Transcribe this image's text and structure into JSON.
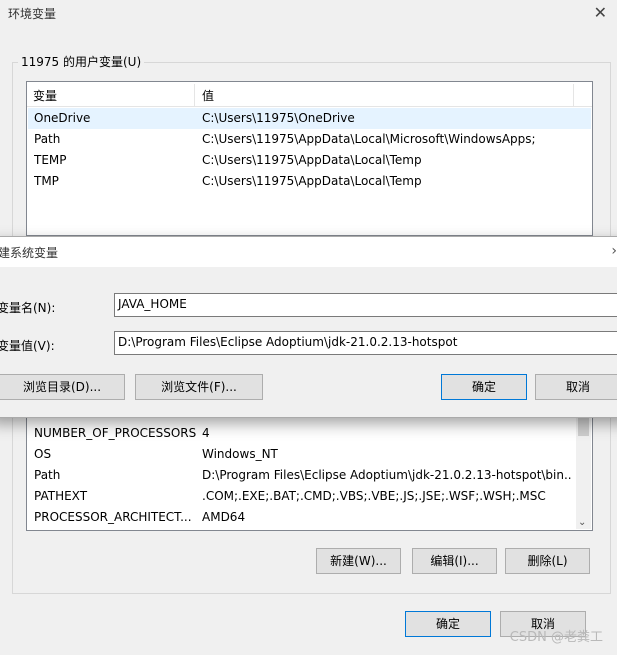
{
  "window": {
    "title": "环境变量",
    "close_icon": "close-icon"
  },
  "user_vars": {
    "group_label": "11975 的用户变量(U)",
    "headers": [
      "变量",
      "值"
    ],
    "rows": [
      {
        "name": "OneDrive",
        "value": "C:\\Users\\11975\\OneDrive",
        "selected": true
      },
      {
        "name": "Path",
        "value": "C:\\Users\\11975\\AppData\\Local\\Microsoft\\WindowsApps;"
      },
      {
        "name": "TEMP",
        "value": "C:\\Users\\11975\\AppData\\Local\\Temp"
      },
      {
        "name": "TMP",
        "value": "C:\\Users\\11975\\AppData\\Local\\Temp"
      }
    ]
  },
  "new_system_var_dialog": {
    "title": "建系统变量",
    "name_label": "变量名(N):",
    "value_label": "变量值(V):",
    "name_value": "JAVA_HOME",
    "value_value": "D:\\Program Files\\Eclipse Adoptium\\jdk-21.0.2.13-hotspot",
    "browse_dir": "浏览目录(D)...",
    "browse_file": "浏览文件(F)...",
    "ok": "确定",
    "cancel": "取消"
  },
  "system_vars": {
    "rows": [
      {
        "name": "NUMBER_OF_PROCESSORS",
        "value": "4"
      },
      {
        "name": "OS",
        "value": "Windows_NT"
      },
      {
        "name": "Path",
        "value": "D:\\Program Files\\Eclipse Adoptium\\jdk-21.0.2.13-hotspot\\bin..."
      },
      {
        "name": "PATHEXT",
        "value": ".COM;.EXE;.BAT;.CMD;.VBS;.VBE;.JS;.JSE;.WSF;.WSH;.MSC"
      },
      {
        "name": "PROCESSOR_ARCHITECT...",
        "value": "AMD64"
      }
    ],
    "buttons": {
      "new": "新建(W)...",
      "edit": "编辑(I)...",
      "delete": "删除(L)"
    }
  },
  "footer": {
    "ok": "确定",
    "cancel": "取消"
  },
  "watermark": "CSDN @老粪工"
}
